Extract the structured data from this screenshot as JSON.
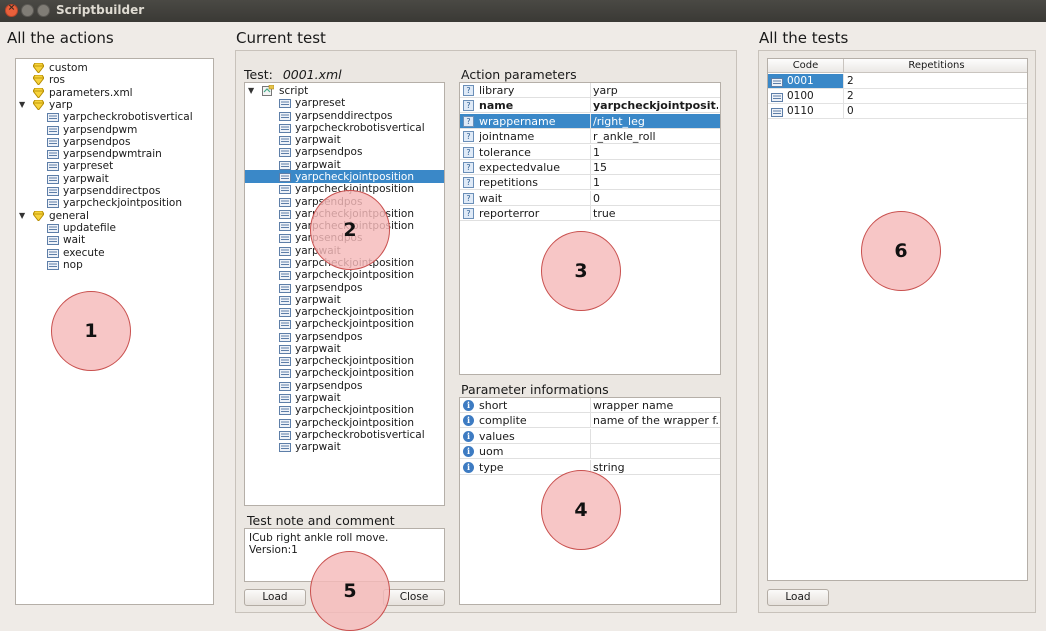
{
  "window": {
    "title": "Scriptbuilder"
  },
  "actions_panel": {
    "title": "All the actions",
    "tree": [
      {
        "label": "custom",
        "level": 0,
        "icon": "gem-icon"
      },
      {
        "label": "ros",
        "level": 0,
        "icon": "gem-icon"
      },
      {
        "label": "parameters.xml",
        "level": 0,
        "icon": "gem-icon"
      },
      {
        "label": "yarp",
        "level": 0,
        "icon": "gem-icon",
        "expanded": true
      },
      {
        "label": "yarpcheckrobotisvertical",
        "level": 1,
        "icon": "doc-icon"
      },
      {
        "label": "yarpsendpwm",
        "level": 1,
        "icon": "doc-icon"
      },
      {
        "label": "yarpsendpos",
        "level": 1,
        "icon": "doc-icon"
      },
      {
        "label": "yarpsendpwmtrain",
        "level": 1,
        "icon": "doc-icon"
      },
      {
        "label": "yarpreset",
        "level": 1,
        "icon": "doc-icon"
      },
      {
        "label": "yarpwait",
        "level": 1,
        "icon": "doc-icon"
      },
      {
        "label": "yarpsenddirectpos",
        "level": 1,
        "icon": "doc-icon"
      },
      {
        "label": "yarpcheckjointposition",
        "level": 1,
        "icon": "doc-icon"
      },
      {
        "label": "general",
        "level": 0,
        "icon": "gem-icon",
        "expanded": true
      },
      {
        "label": "updatefile",
        "level": 1,
        "icon": "doc-icon"
      },
      {
        "label": "wait",
        "level": 1,
        "icon": "doc-icon"
      },
      {
        "label": "execute",
        "level": 1,
        "icon": "doc-icon"
      },
      {
        "label": "nop",
        "level": 1,
        "icon": "doc-icon"
      }
    ]
  },
  "current_test": {
    "title": "Current test",
    "test_label": "Test:",
    "test_file": "0001.xml",
    "root_label": "script",
    "script_items": [
      "yarpreset",
      "yarpsenddirectpos",
      "yarpcheckrobotisvertical",
      "yarpwait",
      "yarpsendpos",
      "yarpwait",
      "yarpcheckjointposition",
      "yarpcheckjointposition",
      "yarpsendpos",
      "yarpcheckjointposition",
      "yarpcheckjointposition",
      "yarpsendpos",
      "yarpwait",
      "yarpcheckjointposition",
      "yarpcheckjointposition",
      "yarpsendpos",
      "yarpwait",
      "yarpcheckjointposition",
      "yarpcheckjointposition",
      "yarpsendpos",
      "yarpwait",
      "yarpcheckjointposition",
      "yarpcheckjointposition",
      "yarpsendpos",
      "yarpwait",
      "yarpcheckjointposition",
      "yarpcheckjointposition",
      "yarpcheckrobotisvertical",
      "yarpwait"
    ],
    "selected_index": 6,
    "note_title": "Test note and comment",
    "note_lines": [
      "ICub right ankle roll move.",
      "Version:1"
    ],
    "load_label": "Load",
    "close_label": "Close"
  },
  "action_parameters": {
    "title": "Action parameters",
    "rows": [
      {
        "key": "library",
        "value": "yarp",
        "bold": false,
        "selected": false
      },
      {
        "key": "name",
        "value": "yarpcheckjointposit...",
        "bold": true,
        "selected": false
      },
      {
        "key": "wrappername",
        "value": "/right_leg",
        "bold": false,
        "selected": true
      },
      {
        "key": "jointname",
        "value": "r_ankle_roll",
        "bold": false,
        "selected": false
      },
      {
        "key": "tolerance",
        "value": "1",
        "bold": false,
        "selected": false
      },
      {
        "key": "expectedvalue",
        "value": "15",
        "bold": false,
        "selected": false
      },
      {
        "key": "repetitions",
        "value": "1",
        "bold": false,
        "selected": false
      },
      {
        "key": "wait",
        "value": "0",
        "bold": false,
        "selected": false
      },
      {
        "key": "reporterror",
        "value": "true",
        "bold": false,
        "selected": false
      }
    ]
  },
  "parameter_info": {
    "title": "Parameter informations",
    "rows": [
      {
        "key": "short",
        "value": "wrapper name"
      },
      {
        "key": "complite",
        "value": "name of the wrapper f..."
      },
      {
        "key": "values",
        "value": ""
      },
      {
        "key": "uom",
        "value": ""
      },
      {
        "key": "type",
        "value": "string"
      }
    ]
  },
  "tests_panel": {
    "title": "All the tests",
    "columns": [
      "Code",
      "Repetitions"
    ],
    "rows": [
      {
        "code": "0001",
        "repetitions": "2",
        "selected": true
      },
      {
        "code": "0100",
        "repetitions": "2",
        "selected": false
      },
      {
        "code": "0110",
        "repetitions": "0",
        "selected": false
      }
    ],
    "load_label": "Load"
  },
  "markers": [
    "1",
    "2",
    "3",
    "4",
    "5",
    "6"
  ],
  "colors": {
    "selection": "#3a88c8",
    "marker_fill": "#f5b9b9",
    "titlebar": "#3c3b37"
  }
}
